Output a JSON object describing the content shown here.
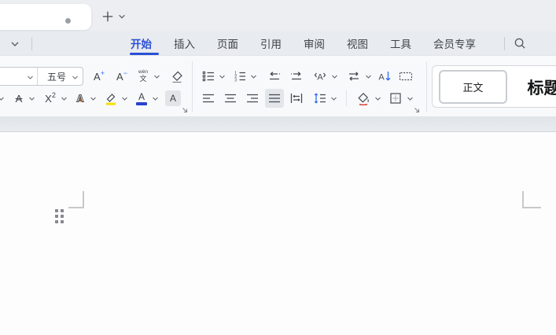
{
  "colors": {
    "accent_blue": "#2b50d5",
    "icon_blue": "#2f6bf4",
    "highlight_yellow": "#f3df0a",
    "font_color_bar_blue": "#2743cf",
    "shading_red_accent": "#d63c30"
  },
  "tabbar": {
    "document_tab": {
      "modified": true
    },
    "icons": {
      "new_tab": "plus-icon",
      "tab_list": "chevron-down-icon"
    }
  },
  "menubar": {
    "tabs": [
      {
        "label": "开始",
        "active": true
      },
      {
        "label": "插入",
        "active": false
      },
      {
        "label": "页面",
        "active": false
      },
      {
        "label": "引用",
        "active": false
      },
      {
        "label": "审阅",
        "active": false
      },
      {
        "label": "视图",
        "active": false
      },
      {
        "label": "工具",
        "active": false
      },
      {
        "label": "会员专享",
        "active": false
      }
    ],
    "icons": {
      "collapse": "chevron-down-icon",
      "search": "magnifier-icon"
    }
  },
  "ribbon": {
    "font_group": {
      "font_size_value": "五号",
      "letters": {
        "a": "A",
        "plus": "+",
        "minus": "−",
        "x": "X",
        "two": "2",
        "pinyin_top": "wén",
        "pinyin_bottom": "文"
      },
      "icons": [
        "font-name-combo",
        "font-size-combo",
        "increase-font-size",
        "decrease-font-size",
        "pinyin-guide",
        "clear-format-eraser",
        "strikethrough",
        "superscript",
        "text-effects",
        "highlight-pen",
        "font-color",
        "character-shading"
      ]
    },
    "paragraph_group": {
      "numbered_list_digits": [
        "1",
        "2",
        "3"
      ],
      "sort_letter": "A",
      "icons": [
        "bullet-list",
        "numbered-list",
        "decrease-indent",
        "increase-indent",
        "text-tools",
        "text-direction",
        "sort",
        "page-frame",
        "align-left",
        "align-center",
        "align-right",
        "justify",
        "distribute-alignment",
        "line-spacing",
        "shading-bucket",
        "borders"
      ],
      "active_button": "justify"
    }
  },
  "styles_gallery": {
    "items": [
      {
        "label": "正文",
        "selected": true
      },
      {
        "label": "标题",
        "selected": false
      }
    ]
  }
}
